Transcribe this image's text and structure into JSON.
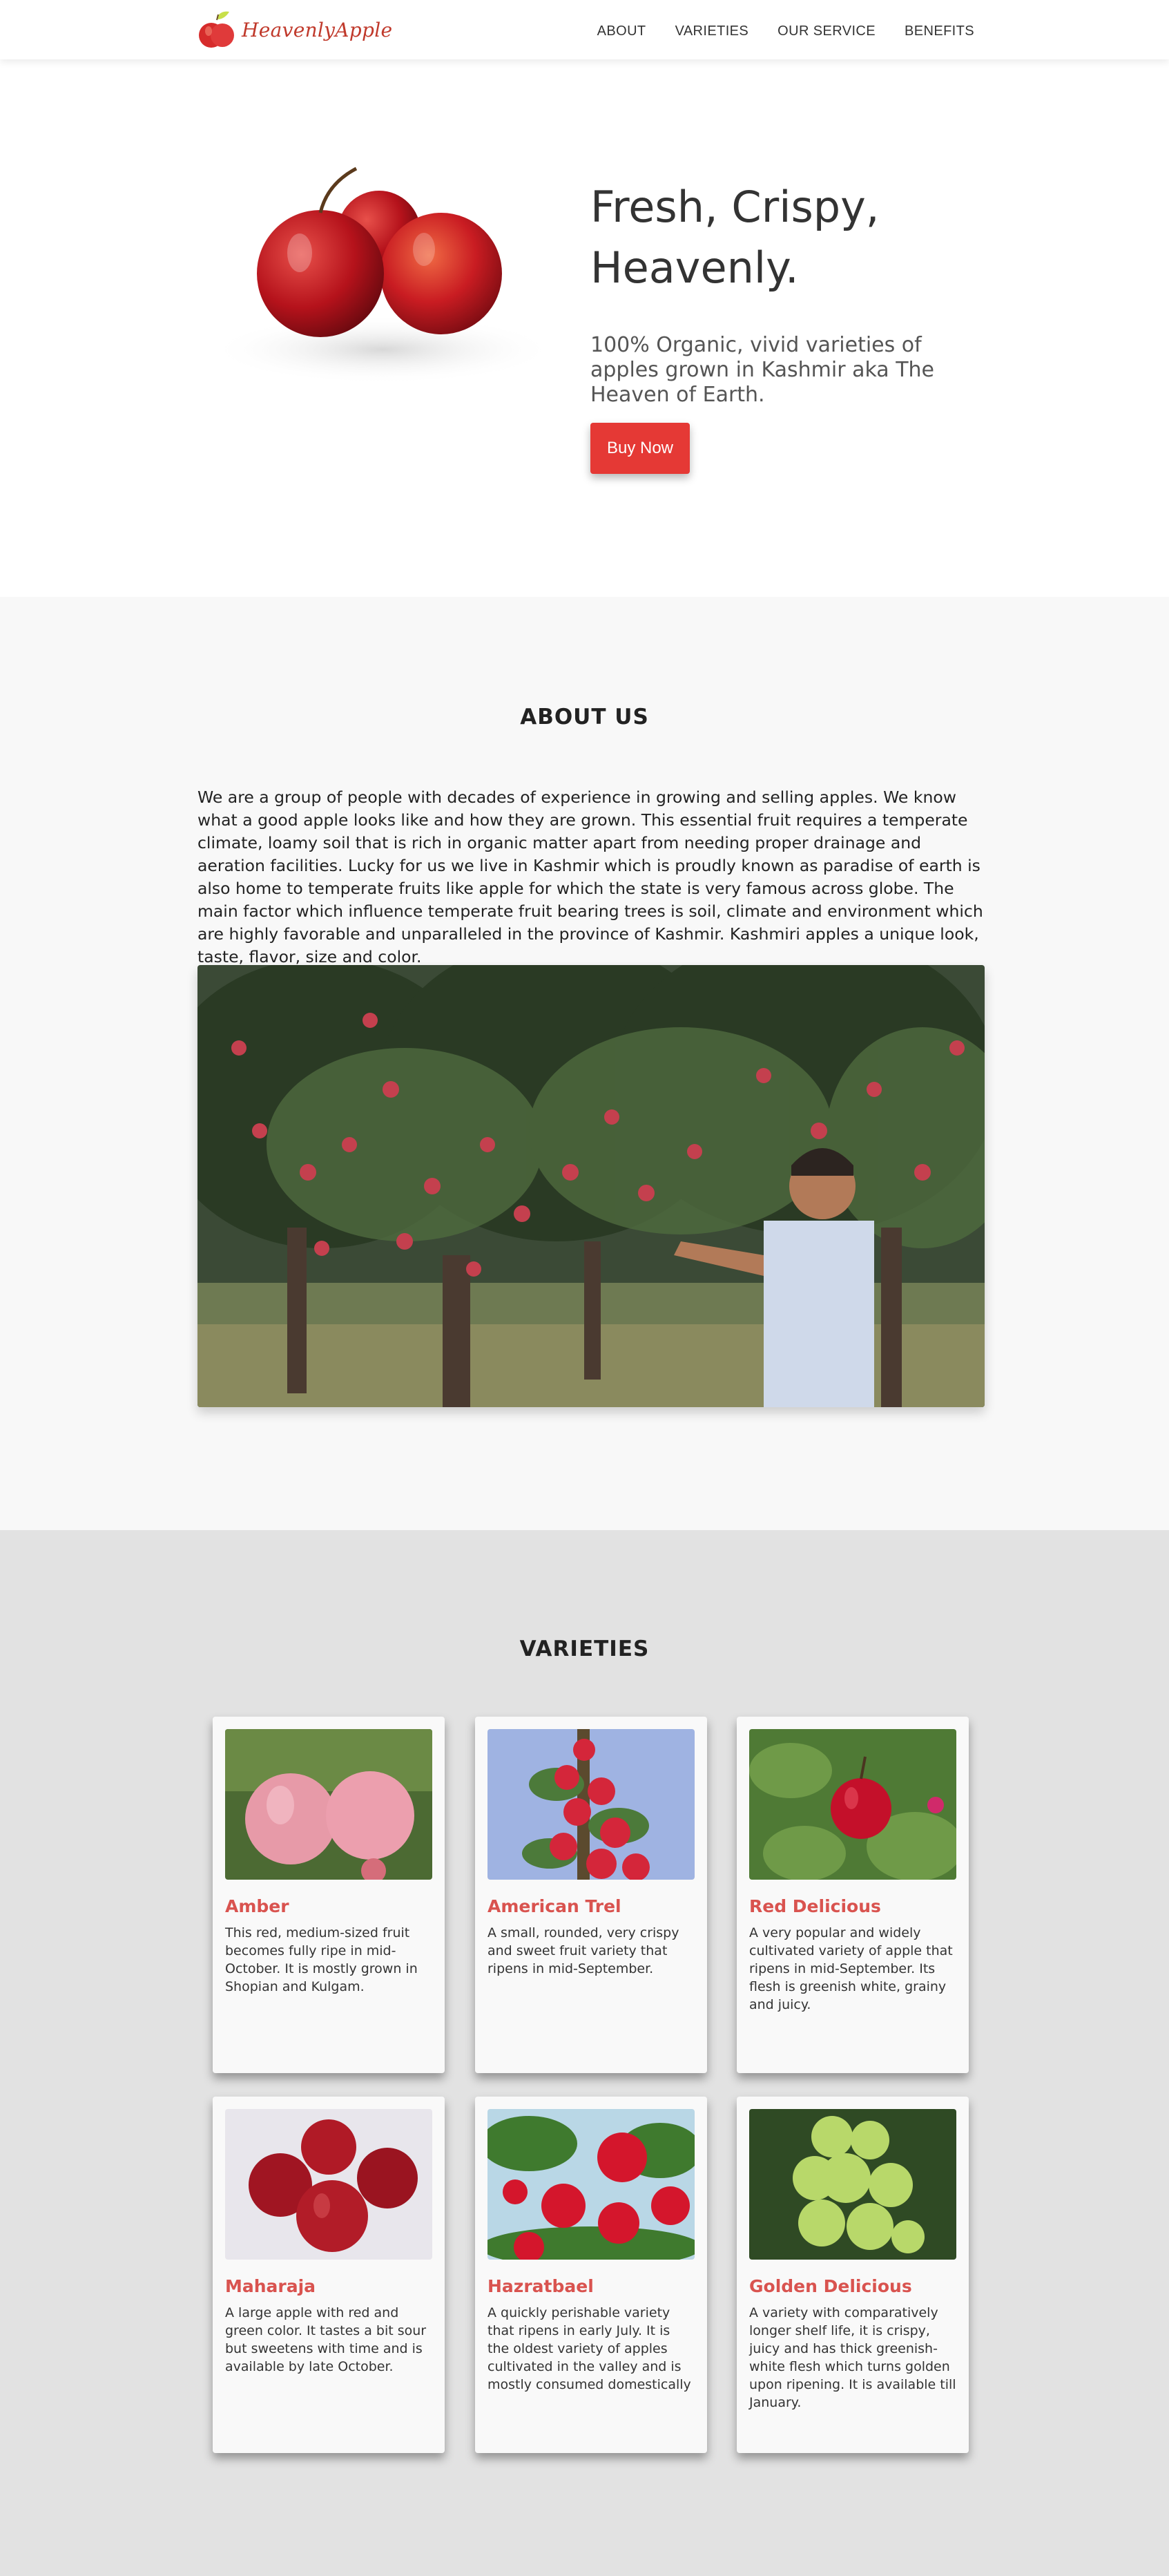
{
  "brand": {
    "name": "HeavenlyApple"
  },
  "nav": {
    "items": [
      "ABOUT",
      "VARIETIES",
      "OUR SERVICE",
      "BENEFITS"
    ]
  },
  "hero": {
    "title": "Fresh, Crispy, Heavenly.",
    "subtitle": "100% Organic, vivid varieties of apples grown in Kashmir aka The Heaven of Earth.",
    "button": "Buy Now"
  },
  "about": {
    "title": "ABOUT US",
    "text": "We are a group of people with decades of experience in growing and selling apples. We know what a good apple looks like and how they are grown. This essential fruit requires a temperate climate, loamy soil that is rich in organic matter apart from needing proper drainage and aeration facilities. Lucky for us we live in Kashmir which is proudly known as paradise of earth is also home to temperate fruits like apple for which the state is very famous across globe. The main factor which influence temperate fruit bearing trees is soil, climate and environment which are highly favorable and unparalleled in the province of Kashmir. Kashmiri apples a unique look, taste, flavor, size and color."
  },
  "varieties": {
    "title": "VARIETIES",
    "cards": [
      {
        "name": "Amber",
        "desc": "This red, medium-sized fruit becomes fully ripe in mid-October. It is mostly grown in Shopian and Kulgam."
      },
      {
        "name": "American Trel",
        "desc": "A small, rounded, very crispy and sweet fruit variety that ripens in mid-September."
      },
      {
        "name": "Red Delicious",
        "desc": "A very popular and widely cultivated variety of apple that ripens in mid-September. Its flesh is greenish white, grainy and juicy."
      },
      {
        "name": "Maharaja",
        "desc": "A large apple with red and green color. It tastes a bit sour but sweetens with time and is available by late October."
      },
      {
        "name": "Hazratbael",
        "desc": "A quickly perishable variety that ripens in early July. It is the oldest variety of apples cultivated in the valley and is mostly consumed domestically"
      },
      {
        "name": "Golden Delicious",
        "desc": "A variety with comparatively longer shelf life, it is crispy, juicy and has thick greenish-white flesh which turns golden upon ripening. It is available till January."
      }
    ]
  },
  "colors": {
    "accent": "#e53935",
    "card_title": "#d9534f",
    "about_bg": "#f8f8f8",
    "varieties_bg": "#e2e2e2"
  }
}
